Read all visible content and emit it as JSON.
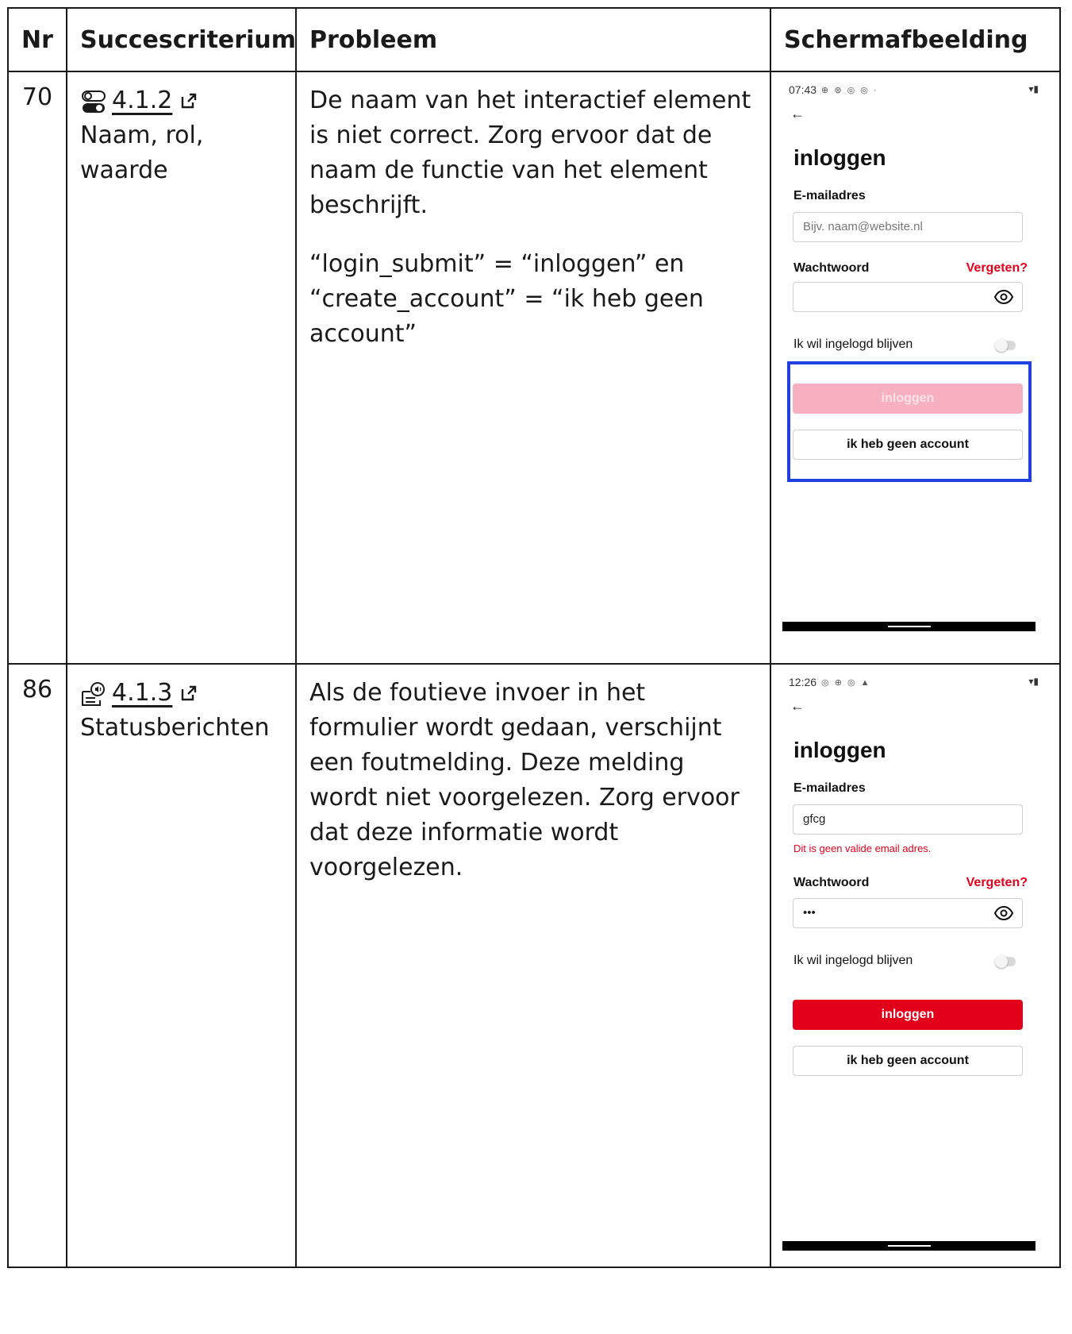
{
  "headers": {
    "nr": "Nr",
    "criterion": "Succescriterium",
    "problem": "Probleem",
    "screenshot": "Schermafbeelding"
  },
  "rows": [
    {
      "nr": "70",
      "criterion_number": "4.1.2",
      "criterion_name": "Naam, rol, waarde",
      "criterion_icon": "toggle-switch-icon",
      "problem_paragraphs": [
        "De naam van het interactief element is niet correct. Zorg ervoor dat de naam de functie van het element beschrijft.",
        "“login_submit” = “inloggen” en “create_account” = “ik heb geen account”"
      ],
      "screen": {
        "time": "07:43",
        "status_icons": "⊕ ⊛ ◎ ◎ ·",
        "title": "inloggen",
        "email_label": "E-mailadres",
        "email_placeholder": "Bijv. naam@website.nl",
        "password_label": "Wachtwoord",
        "forgot": "Vergeten?",
        "remember": "Ik wil ingelogd blijven",
        "login_button": "inloggen",
        "login_state": "disabled",
        "account_button": "ik heb geen account",
        "highlight_color": "#1f3fe0"
      }
    },
    {
      "nr": "86",
      "criterion_number": "4.1.3",
      "criterion_name": "Statusberichten",
      "criterion_icon": "status-message-icon",
      "problem_paragraphs": [
        "Als de foutieve invoer in het formulier wordt gedaan, verschijnt een foutmelding. Deze melding wordt niet voorgelezen. Zorg ervoor dat deze informatie wordt voorgelezen."
      ],
      "screen": {
        "time": "12:26",
        "status_icons": "◎ ⊕ ◎ ▲",
        "title": "inloggen",
        "email_label": "E-mailadres",
        "email_value": "gfcg",
        "email_error": "Dit is geen valide email adres.",
        "password_label": "Wachtwoord",
        "password_value": "•••",
        "forgot": "Vergeten?",
        "remember": "Ik wil ingelogd blijven",
        "login_button": "inloggen",
        "login_state": "enabled",
        "account_button": "ik heb geen account"
      }
    }
  ],
  "colors": {
    "brand_red": "#e3001b",
    "disabled_pink": "#f6b0c0",
    "highlight_blue": "#1f3fe0"
  }
}
